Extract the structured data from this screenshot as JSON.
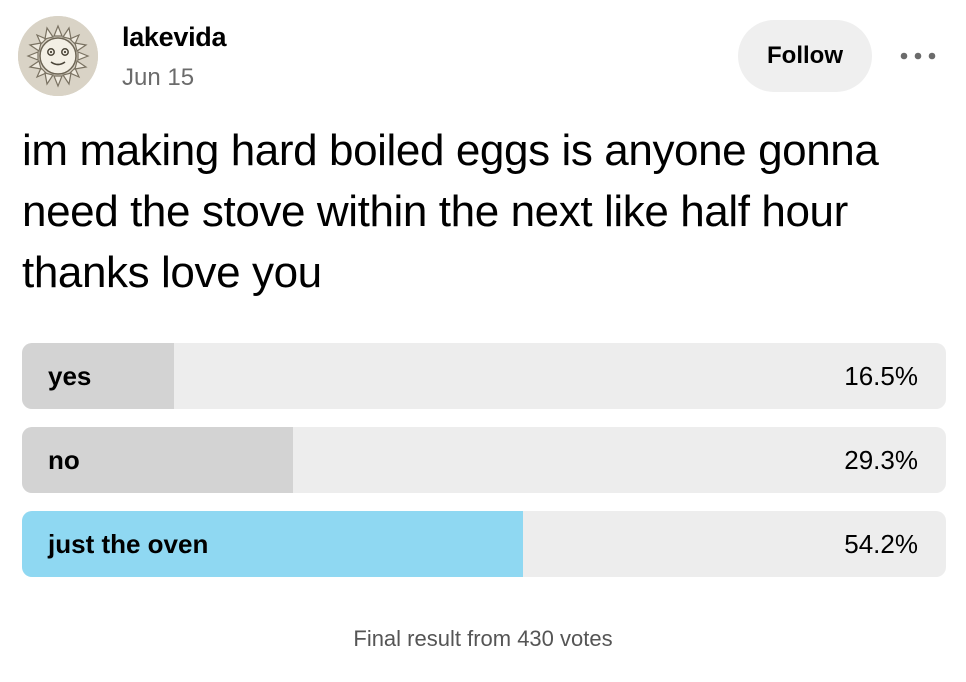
{
  "post": {
    "author": "lakevida",
    "date": "Jun 15",
    "follow_label": "Follow",
    "more_icon": "more-dots-icon",
    "avatar_icon": "sun-face-avatar",
    "text": "im making hard boiled eggs is anyone gonna need the stove within the next like half hour thanks love you"
  },
  "poll": {
    "options": [
      {
        "label": "yes",
        "percent": "16.5%",
        "value": 16.5,
        "winner": false
      },
      {
        "label": "no",
        "percent": "29.3%",
        "value": 29.3,
        "winner": false
      },
      {
        "label": "just the oven",
        "percent": "54.2%",
        "value": 54.2,
        "winner": true
      }
    ],
    "footer": "Final result from 430 votes"
  },
  "colors": {
    "bar_track": "#ededed",
    "bar_fill": "#d3d3d3",
    "winner_fill": "#8fd8f2",
    "follow_bg": "#efefef",
    "date_text": "#6b6b6b"
  }
}
